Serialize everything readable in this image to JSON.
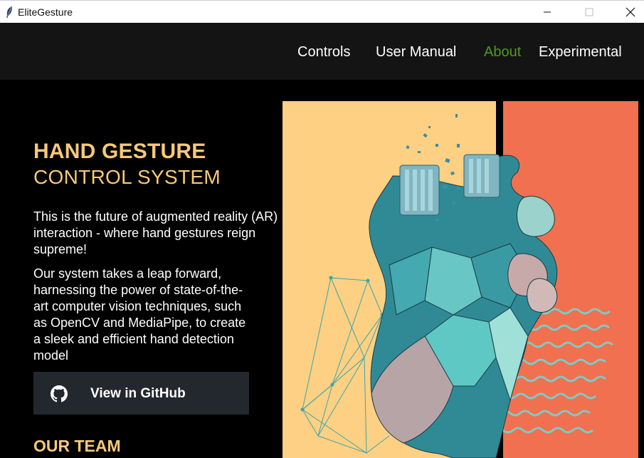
{
  "window": {
    "title": "EliteGesture",
    "min_symbol": "—",
    "close_symbol": "✕"
  },
  "nav": {
    "controls": "Controls",
    "user_manual": "User Manual",
    "about": "About",
    "experimental": "Experimental",
    "active_color": "#4f9a1d"
  },
  "hero": {
    "title": "HAND GESTURE",
    "subtitle": "CONTROL SYSTEM",
    "paragraph1": "This is the future of augmented reality (AR) interaction - where hand gestures reign supreme!",
    "paragraph2": "Our system takes a leap forward, harnessing the power of state-of-the-art computer vision techniques, such as OpenCV and MediaPipe, to create a sleek and efficient hand detection model",
    "github_button": "View in GitHub",
    "team_heading": "OUR TEAM"
  },
  "colors": {
    "accent": "#f7c977",
    "panel_yellow": "#fdd083",
    "panel_coral": "#f07050",
    "button_bg": "#23272e"
  },
  "icons": {
    "app": "feather-icon",
    "github": "github-icon",
    "hand_art": "3d-hand-illustration"
  }
}
